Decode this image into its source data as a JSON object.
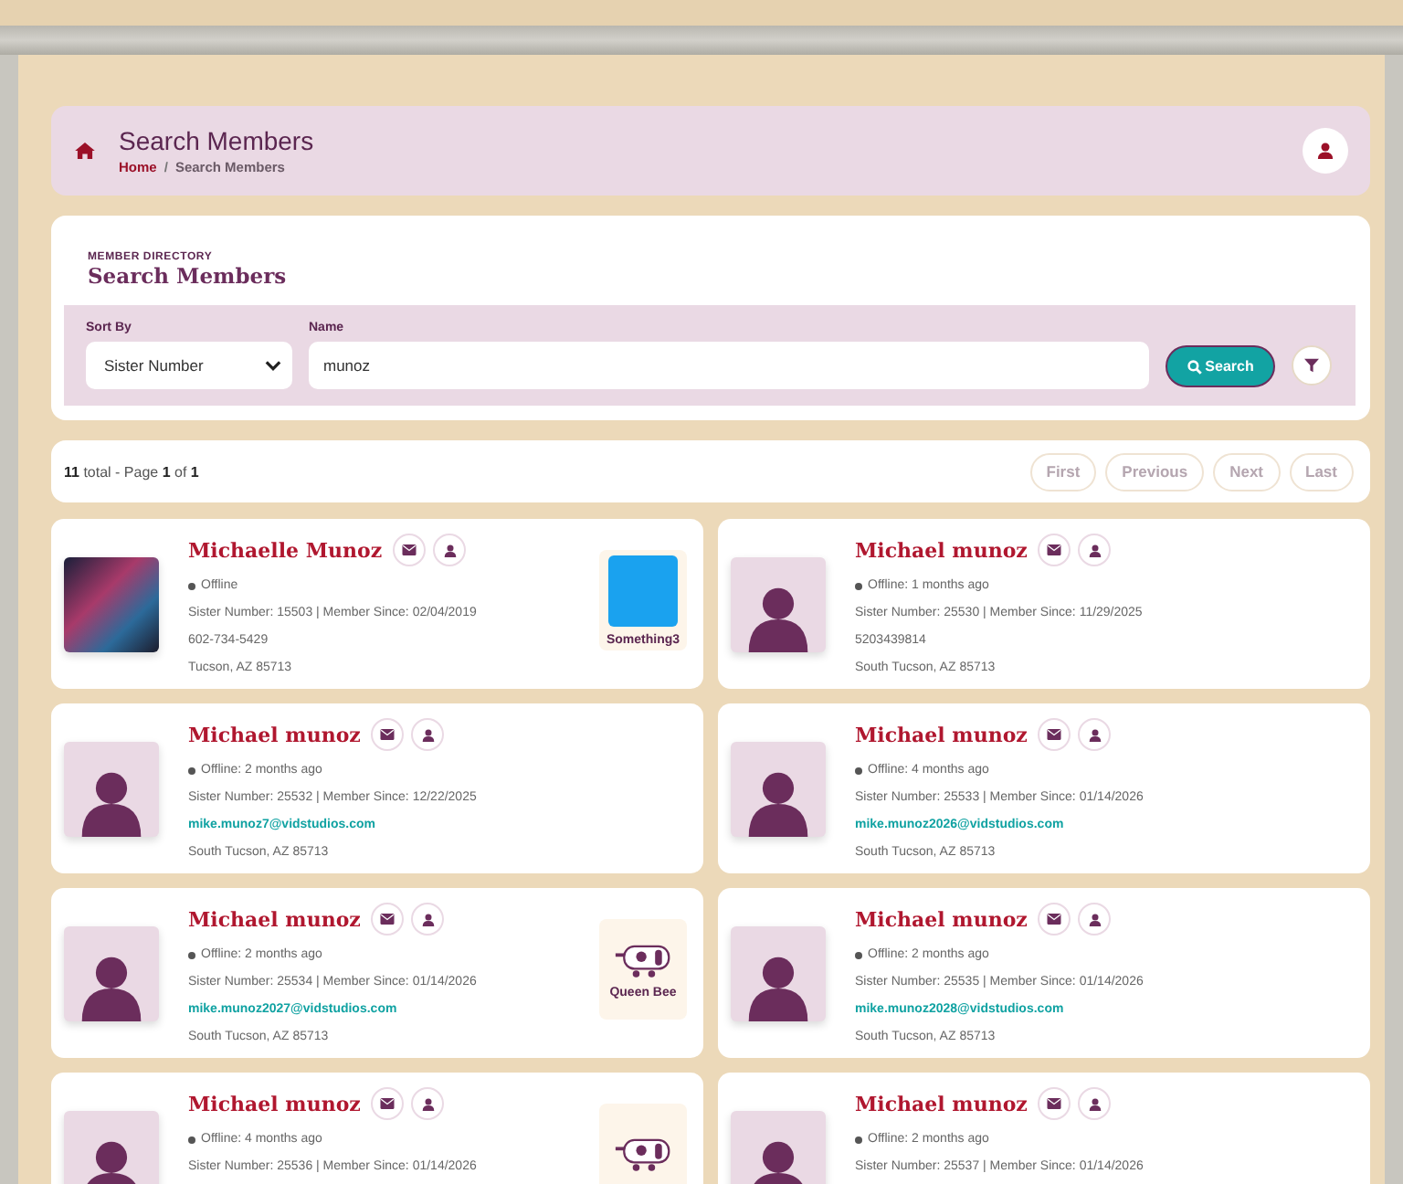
{
  "breadcrumb_bar": {
    "title": "Search Members",
    "separator": "/",
    "crumbs": [
      {
        "label": "Home",
        "kind": "link"
      },
      {
        "label": "Search Members",
        "kind": "current"
      }
    ]
  },
  "directory": {
    "eyebrow": "MEMBER DIRECTORY",
    "title": "Search Members",
    "sort_by": {
      "label": "Sort By",
      "value": "Sister Number"
    },
    "name": {
      "label": "Name",
      "value": "munoz"
    },
    "search_button": "Search"
  },
  "pagination": {
    "summary": "**11** total - Page **1** of **1**",
    "buttons": [
      {
        "label": "First",
        "disabled": true
      },
      {
        "label": "Previous",
        "disabled": true
      },
      {
        "label": "Next",
        "disabled": true
      },
      {
        "label": "Last",
        "disabled": true
      }
    ]
  },
  "members": [
    {
      "name": "Michaelle Munoz",
      "has_photo": true,
      "status": "Offline",
      "details": "Sister Number: 15503 | Member Since: 02/04/2019",
      "contact": {
        "kind": "phone",
        "text": "602-734-5429"
      },
      "location": "Tucson, AZ 85713",
      "badge": {
        "kind": "photo",
        "label": "Something3"
      }
    },
    {
      "name": "Michael munoz",
      "has_photo": false,
      "status": "Offline: 1 months ago",
      "details": "Sister Number: 25530 | Member Since: 11/29/2025",
      "contact": {
        "kind": "phone",
        "text": "5203439814"
      },
      "location": "South Tucson, AZ 85713"
    },
    {
      "name": "Michael munoz",
      "has_photo": false,
      "status": "Offline: 2 months ago",
      "details": "Sister Number: 25532 | Member Since: 12/22/2025",
      "contact": {
        "kind": "email",
        "text": "mike.munoz7@vidstudios.com"
      },
      "location": "South Tucson, AZ 85713"
    },
    {
      "name": "Michael munoz",
      "has_photo": false,
      "status": "Offline: 4 months ago",
      "details": "Sister Number: 25533 | Member Since: 01/14/2026",
      "contact": {
        "kind": "email",
        "text": "mike.munoz2026@vidstudios.com"
      },
      "location": "South Tucson, AZ 85713"
    },
    {
      "name": "Michael munoz",
      "has_photo": false,
      "status": "Offline: 2 months ago",
      "details": "Sister Number: 25534 | Member Since: 01/14/2026",
      "contact": {
        "kind": "email",
        "text": "mike.munoz2027@vidstudios.com"
      },
      "location": "South Tucson, AZ 85713",
      "badge": {
        "kind": "trailer",
        "label": "Queen Bee"
      }
    },
    {
      "name": "Michael munoz",
      "has_photo": false,
      "status": "Offline: 2 months ago",
      "details": "Sister Number: 25535 | Member Since: 01/14/2026",
      "contact": {
        "kind": "email",
        "text": "mike.munoz2028@vidstudios.com"
      },
      "location": "South Tucson, AZ 85713"
    },
    {
      "name": "Michael munoz",
      "has_photo": false,
      "status": "Offline: 4 months ago",
      "details": "Sister Number: 25536 | Member Since: 01/14/2026",
      "badge": {
        "kind": "trailer"
      }
    },
    {
      "name": "Michael munoz",
      "has_photo": false,
      "status": "Offline: 2 months ago",
      "details": "Sister Number: 25537 | Member Since: 01/14/2026"
    }
  ]
}
